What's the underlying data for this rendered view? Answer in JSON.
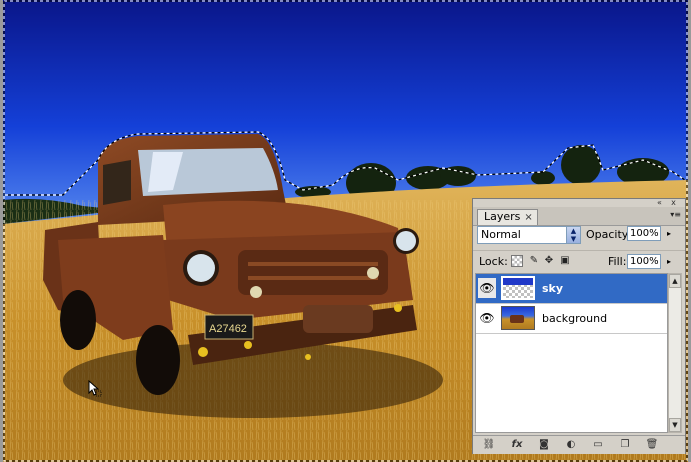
{
  "panel": {
    "tab_label": "Layers",
    "tab_close": "×",
    "panel_menu_icon": "panel-menu-icon",
    "title_buttons": {
      "collapse": "«",
      "close": "x"
    },
    "blend_mode": "Normal",
    "opacity_label": "Opacity:",
    "opacity_value": "100%",
    "lock_label": "Lock:",
    "fill_label": "Fill:",
    "fill_value": "100%",
    "lock_icons": [
      "lock-transparent-icon",
      "lock-image-icon",
      "lock-position-icon",
      "lock-all-icon"
    ],
    "layers": [
      {
        "name": "sky",
        "selected": true,
        "visible": true
      },
      {
        "name": "background",
        "selected": false,
        "visible": true
      }
    ],
    "bottom_icons": [
      "link-layers-icon",
      "fx-icon",
      "add-mask-icon",
      "adjustment-layer-icon",
      "new-group-icon",
      "new-layer-icon",
      "delete-layer-icon"
    ]
  },
  "colors": {
    "sky_top": "#0a1a8a",
    "sky_bottom": "#4f7fe8",
    "field": "#c9962e",
    "truck": "#7a3a1c",
    "selection_highlight": "#316ac5"
  }
}
